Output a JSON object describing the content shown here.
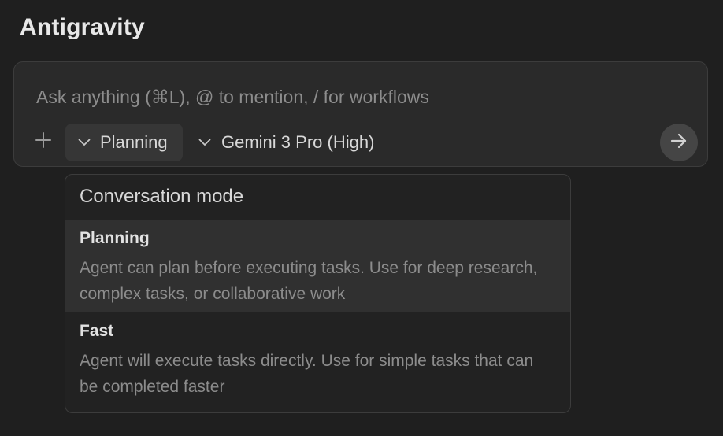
{
  "app": {
    "title": "Antigravity"
  },
  "composer": {
    "placeholder": "Ask anything (⌘L), @ to mention, / for workflows",
    "value": "",
    "mode_label": "Planning",
    "model_label": "Gemini 3 Pro (High)",
    "icons": {
      "add": "plus-icon",
      "mode_chevron": "chevron-down-icon",
      "model_chevron": "chevron-down-icon",
      "send": "arrow-right-icon"
    }
  },
  "mode_menu": {
    "header": "Conversation mode",
    "options": [
      {
        "title": "Planning",
        "description": "Agent can plan before executing tasks. Use for deep research, complex tasks, or collaborative work",
        "selected": true
      },
      {
        "title": "Fast",
        "description": "Agent will execute tasks directly. Use for simple tasks that can be completed faster",
        "selected": false
      }
    ]
  },
  "colors": {
    "background": "#1f1f1f",
    "composer_bg": "#2a2a2a",
    "selected_option_bg": "#303030",
    "muted_text": "#8c8c8c"
  }
}
